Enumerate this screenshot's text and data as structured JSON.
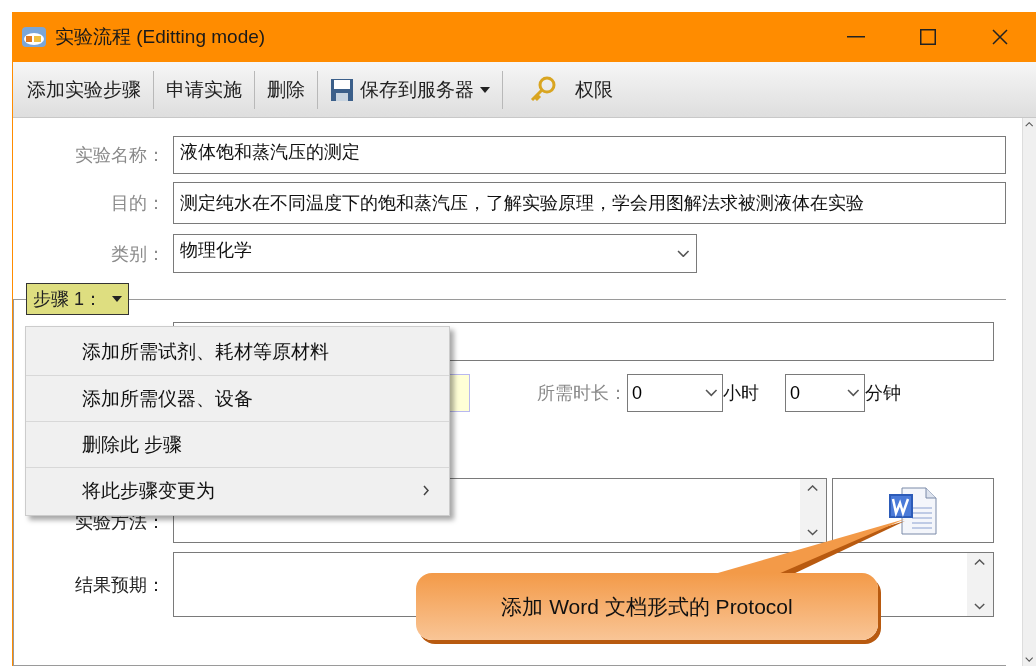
{
  "window": {
    "title": "实验流程 (Editting mode)"
  },
  "toolbar": [
    {
      "kind": "text",
      "label": "添加实验步骤"
    },
    {
      "kind": "text",
      "label": "申请实施"
    },
    {
      "kind": "text",
      "label": "删除"
    },
    {
      "kind": "save-split",
      "label": "保存到服务器"
    },
    {
      "kind": "key",
      "label": "权限"
    }
  ],
  "form": {
    "name_label": "实验名称：",
    "name": "液体饱和蒸汽压的测定",
    "purpose_label": "目的：",
    "purpose": "测定纯水在不同温度下的饱和蒸汽压，了解实验原理，学会用图解法求被测液体在实验",
    "category_label": "类别：",
    "category": "物理化学"
  },
  "step": {
    "header": "步骤 1：",
    "duration_label": "所需时长：",
    "hours": "0",
    "hours_unit": "小时",
    "minutes": "0",
    "minutes_unit": "分钟",
    "method_label": "实验方法：",
    "expect_label": "结果预期："
  },
  "context_menu": [
    {
      "kind": "action",
      "label": "添加所需试剂、耗材等原材料"
    },
    {
      "kind": "action",
      "label": "添加所需仪器、设备"
    },
    {
      "kind": "action",
      "label": "删除此 步骤"
    },
    {
      "kind": "submenu",
      "label": "将此步骤变更为"
    }
  ],
  "callout": {
    "text": "添加 Word 文档形式的 Protocol"
  }
}
